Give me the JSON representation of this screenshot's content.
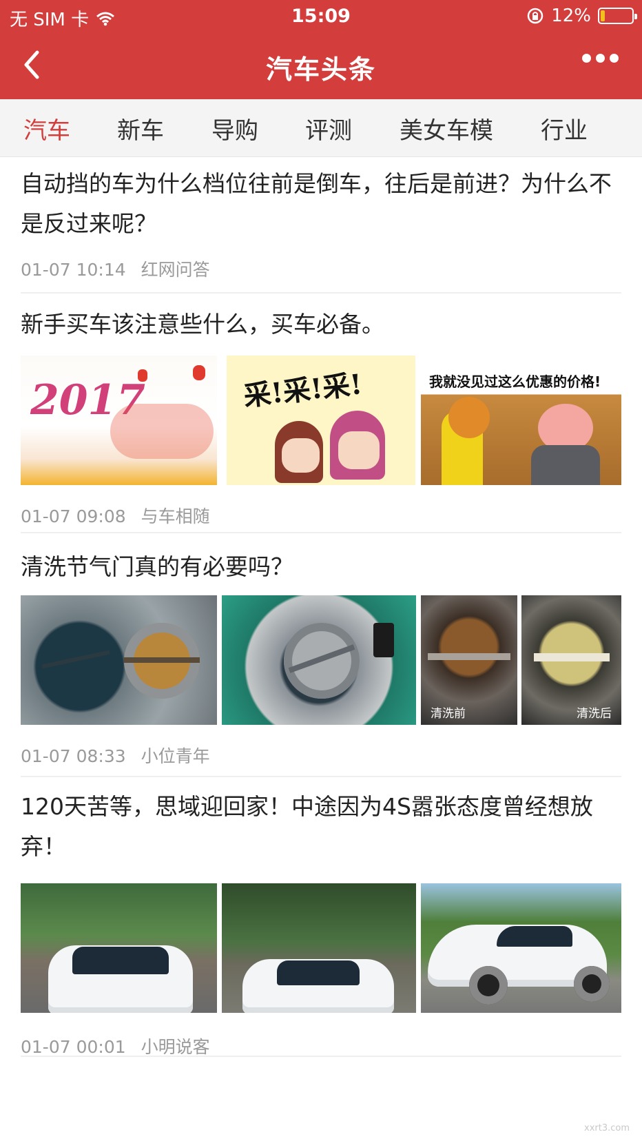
{
  "status": {
    "carrier": "无 SIM 卡",
    "time": "15:09",
    "battery": "12%",
    "battery_level": 0.12
  },
  "nav": {
    "title": "汽车头条"
  },
  "tabs": [
    {
      "label": "汽车",
      "active": true
    },
    {
      "label": "新车"
    },
    {
      "label": "导购"
    },
    {
      "label": "评测"
    },
    {
      "label": "美女车模"
    },
    {
      "label": "行业"
    }
  ],
  "articles": [
    {
      "title": "自动挡的车为什么档位往前是倒车，往后是前进？为什么不是反过来呢？",
      "time": "01-07 10:14",
      "source": "红网问答"
    },
    {
      "title": "新手买车该注意些什么，买车必备。",
      "time": "01-07 09:08",
      "source": "与车相随",
      "images": [
        "2017",
        "采!采!采!",
        "我就没见过这么优惠的价格!"
      ]
    },
    {
      "title": "清洗节气门真的有必要吗？",
      "time": "01-07 08:33",
      "source": "小位青年",
      "images": [
        "",
        "",
        "清洗前",
        "清洗后"
      ]
    },
    {
      "title": "120天苦等，思域迎回家！中途因为4S嚣张态度曾经想放弃！",
      "time": "01-07 00:01",
      "source": "小明说客"
    }
  ],
  "watermark": "xxrt3.com",
  "colors": {
    "brand": "#d33d3c",
    "tab_bg": "#f4f4f4",
    "meta": "#9a9a9a"
  }
}
